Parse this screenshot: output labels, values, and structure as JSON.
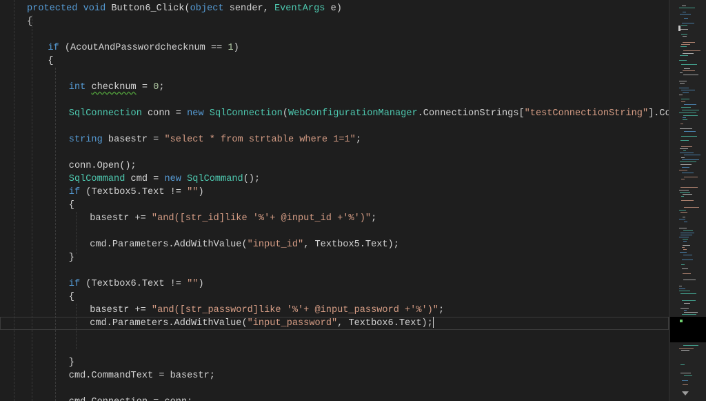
{
  "editor": {
    "current_line_index": 25,
    "code_lines": [
      {
        "indent": 0,
        "tokens": [
          [
            "kw",
            "protected"
          ],
          [
            "plain",
            " "
          ],
          [
            "kw",
            "void"
          ],
          [
            "plain",
            " Button6_Click("
          ],
          [
            "kw",
            "object"
          ],
          [
            "plain",
            " sender, "
          ],
          [
            "type",
            "EventArgs"
          ],
          [
            "plain",
            " e)"
          ]
        ]
      },
      {
        "indent": 0,
        "tokens": [
          [
            "plain",
            "{"
          ]
        ]
      },
      {
        "indent": 0,
        "tokens": []
      },
      {
        "indent": 4,
        "tokens": [
          [
            "kw",
            "if"
          ],
          [
            "plain",
            " (AcoutAndPasswordchecknum == "
          ],
          [
            "num",
            "1"
          ],
          [
            "plain",
            ")"
          ]
        ]
      },
      {
        "indent": 4,
        "tokens": [
          [
            "plain",
            "{"
          ]
        ]
      },
      {
        "indent": 0,
        "tokens": []
      },
      {
        "indent": 8,
        "tokens": [
          [
            "kw",
            "int"
          ],
          [
            "plain",
            " "
          ],
          [
            "squiggle",
            "checknum"
          ],
          [
            "plain",
            " = "
          ],
          [
            "num",
            "0"
          ],
          [
            "plain",
            ";"
          ]
        ]
      },
      {
        "indent": 0,
        "tokens": []
      },
      {
        "indent": 8,
        "tokens": [
          [
            "type",
            "SqlConnection"
          ],
          [
            "plain",
            " conn = "
          ],
          [
            "kw",
            "new"
          ],
          [
            "plain",
            " "
          ],
          [
            "type",
            "SqlConnection"
          ],
          [
            "plain",
            "("
          ],
          [
            "type",
            "WebConfigurationManager"
          ],
          [
            "plain",
            ".ConnectionStrings["
          ],
          [
            "str",
            "\"testConnectionString\""
          ],
          [
            "plain",
            "].ConnectionStri"
          ]
        ]
      },
      {
        "indent": 0,
        "tokens": []
      },
      {
        "indent": 8,
        "tokens": [
          [
            "kw",
            "string"
          ],
          [
            "plain",
            " basestr = "
          ],
          [
            "str",
            "\"select * from strtable where 1=1\""
          ],
          [
            "plain",
            ";"
          ]
        ]
      },
      {
        "indent": 0,
        "tokens": []
      },
      {
        "indent": 8,
        "tokens": [
          [
            "plain",
            "conn.Open();"
          ]
        ]
      },
      {
        "indent": 8,
        "tokens": [
          [
            "type",
            "SqlCommand"
          ],
          [
            "plain",
            " cmd = "
          ],
          [
            "kw",
            "new"
          ],
          [
            "plain",
            " "
          ],
          [
            "type",
            "SqlCommand"
          ],
          [
            "plain",
            "();"
          ]
        ]
      },
      {
        "indent": 8,
        "tokens": [
          [
            "kw",
            "if"
          ],
          [
            "plain",
            " (Textbox5.Text != "
          ],
          [
            "str",
            "\"\""
          ],
          [
            "plain",
            ")"
          ]
        ]
      },
      {
        "indent": 8,
        "tokens": [
          [
            "plain",
            "{"
          ]
        ]
      },
      {
        "indent": 12,
        "tokens": [
          [
            "plain",
            "basestr += "
          ],
          [
            "str",
            "\"and([str_id]like '%'+ @input_id +'%')\""
          ],
          [
            "plain",
            ";"
          ]
        ]
      },
      {
        "indent": 0,
        "tokens": []
      },
      {
        "indent": 12,
        "tokens": [
          [
            "plain",
            "cmd.Parameters.AddWithValue("
          ],
          [
            "str",
            "\"input_id\""
          ],
          [
            "plain",
            ", Textbox5.Text);"
          ]
        ]
      },
      {
        "indent": 8,
        "tokens": [
          [
            "plain",
            "}"
          ]
        ]
      },
      {
        "indent": 0,
        "tokens": []
      },
      {
        "indent": 8,
        "tokens": [
          [
            "kw",
            "if"
          ],
          [
            "plain",
            " (Textbox6.Text != "
          ],
          [
            "str",
            "\"\""
          ],
          [
            "plain",
            ")"
          ]
        ]
      },
      {
        "indent": 8,
        "tokens": [
          [
            "plain",
            "{"
          ]
        ]
      },
      {
        "indent": 12,
        "tokens": [
          [
            "plain",
            "basestr += "
          ],
          [
            "str",
            "\"and([str_password]like '%'+ @input_password +'%')\""
          ],
          [
            "plain",
            ";"
          ]
        ]
      },
      {
        "indent": 12,
        "tokens": [
          [
            "plain",
            "cmd.Parameters.AddWithValue("
          ],
          [
            "str",
            "\"input_password\""
          ],
          [
            "plain",
            ", Textbox6.Text);"
          ]
        ]
      },
      {
        "indent": 0,
        "tokens": []
      },
      {
        "indent": 0,
        "tokens": []
      },
      {
        "indent": 8,
        "tokens": [
          [
            "plain",
            "}"
          ]
        ]
      },
      {
        "indent": 8,
        "tokens": [
          [
            "plain",
            "cmd.CommandText = basestr;"
          ]
        ]
      },
      {
        "indent": 0,
        "tokens": []
      },
      {
        "indent": 8,
        "tokens": [
          [
            "plain",
            "cmd.Connection = conn;"
          ]
        ]
      }
    ]
  },
  "minimap": {
    "icon": "scroll-down-arrow-icon"
  },
  "colors": {
    "background": "#1e1e1e",
    "keyword": "#569cd6",
    "type": "#4ec9b0",
    "string": "#d69d85",
    "number": "#b5cea8",
    "text": "#d4d4d4"
  }
}
